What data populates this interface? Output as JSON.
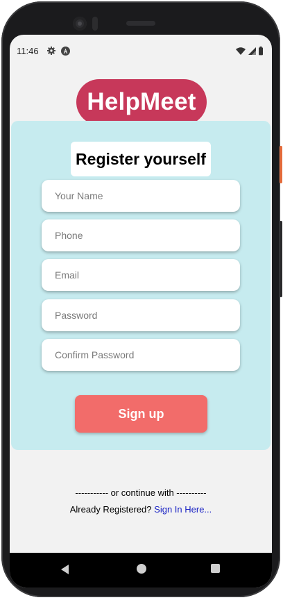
{
  "status_bar": {
    "time": "11:46",
    "icons": [
      "settings-gear-icon",
      "accessibility-a-icon",
      "wifi-icon",
      "cell-signal-icon",
      "battery-icon"
    ]
  },
  "brand": {
    "name": "HelpMeet",
    "color": "#c7385a"
  },
  "form": {
    "title": "Register yourself",
    "background": "#c6ebef",
    "fields": [
      {
        "placeholder": "Your Name",
        "value": ""
      },
      {
        "placeholder": "Phone",
        "value": ""
      },
      {
        "placeholder": "Email",
        "value": ""
      },
      {
        "placeholder": "Password",
        "value": ""
      },
      {
        "placeholder": "Confirm Password",
        "value": ""
      }
    ],
    "signup_label": "Sign up",
    "signup_color": "#f26c6a"
  },
  "footer": {
    "divider": "----------- or continue with ----------",
    "already_registered": "Already Registered?",
    "signin_link": "Sign In Here...",
    "link_color": "#1a23c4"
  },
  "nav": {
    "icons": [
      "back-icon",
      "home-icon",
      "recents-icon"
    ]
  }
}
